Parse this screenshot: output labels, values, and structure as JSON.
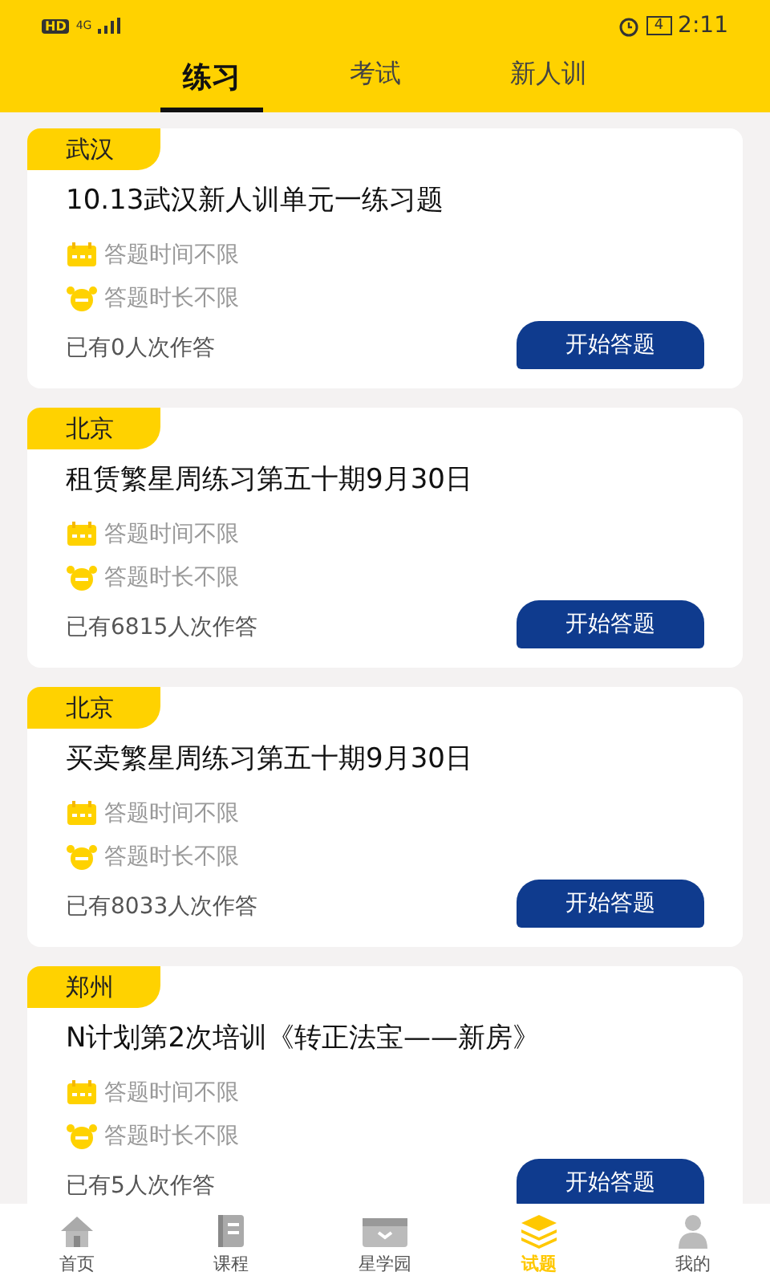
{
  "status_bar": {
    "hd": "HD",
    "network": "4G",
    "time": "2:11",
    "battery": "4"
  },
  "tabs": [
    {
      "label": "练习",
      "selected": true
    },
    {
      "label": "考试",
      "selected": false
    },
    {
      "label": "新人训",
      "selected": false
    }
  ],
  "exercises": [
    {
      "city": "武汉",
      "title": "10.13武汉新人训单元一练习题",
      "time_limit": "答题时间不限",
      "duration_limit": "答题时长不限",
      "count": "已有0人次作答",
      "button": "开始答题"
    },
    {
      "city": "北京",
      "title": "租赁繁星周练习第五十期9月30日",
      "time_limit": "答题时间不限",
      "duration_limit": "答题时长不限",
      "count": "已有6815人次作答",
      "button": "开始答题"
    },
    {
      "city": "北京",
      "title": "买卖繁星周练习第五十期9月30日",
      "time_limit": "答题时间不限",
      "duration_limit": "答题时长不限",
      "count": "已有8033人次作答",
      "button": "开始答题"
    },
    {
      "city": "郑州",
      "title": "N计划第2次培训《转正法宝——新房》",
      "time_limit": "答题时间不限",
      "duration_limit": "答题时长不限",
      "count": "已有5人次作答",
      "button": "开始答题"
    }
  ],
  "bottom_nav": [
    {
      "label": "首页",
      "kind": "home",
      "selected": false
    },
    {
      "label": "课程",
      "kind": "course",
      "selected": false
    },
    {
      "label": "星学园",
      "kind": "campus",
      "selected": false
    },
    {
      "label": "试题",
      "kind": "exam",
      "selected": true
    },
    {
      "label": "我的",
      "kind": "profile",
      "selected": false
    }
  ]
}
